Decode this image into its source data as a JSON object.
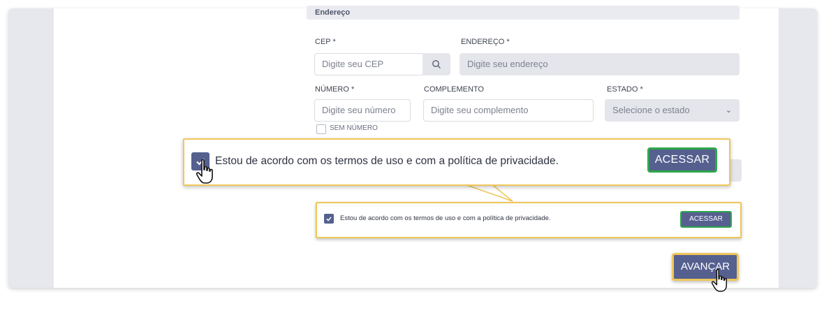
{
  "address_section": {
    "title": "Endereço",
    "cep": {
      "label": "CEP *",
      "placeholder": "Digite seu CEP"
    },
    "endereco": {
      "label": "ENDEREÇO *",
      "placeholder": "Digite seu endereço"
    },
    "numero": {
      "label": "NÚMERO *",
      "placeholder": "Digite seu número"
    },
    "complemento": {
      "label": "COMPLEMENTO",
      "placeholder": "Digite seu complemento"
    },
    "estado": {
      "label": "ESTADO *",
      "selected": "Selecione o estado"
    },
    "sem_numero_label": "SEM NÚMERO"
  },
  "terms": {
    "text": "Estou de acordo com os termos de uso e com a política de privacidade.",
    "checked": true,
    "button_label": "ACESSAR"
  },
  "footer": {
    "next_label": "AVANÇAR"
  },
  "colors": {
    "primary": "#55608f",
    "highlight_border": "#f0c65a",
    "success_border": "#2ea84a",
    "field_gray": "#e4e6eb"
  },
  "icons": [
    "search-icon",
    "chevron-down-icon",
    "check-icon",
    "hand-pointer-icon"
  ]
}
